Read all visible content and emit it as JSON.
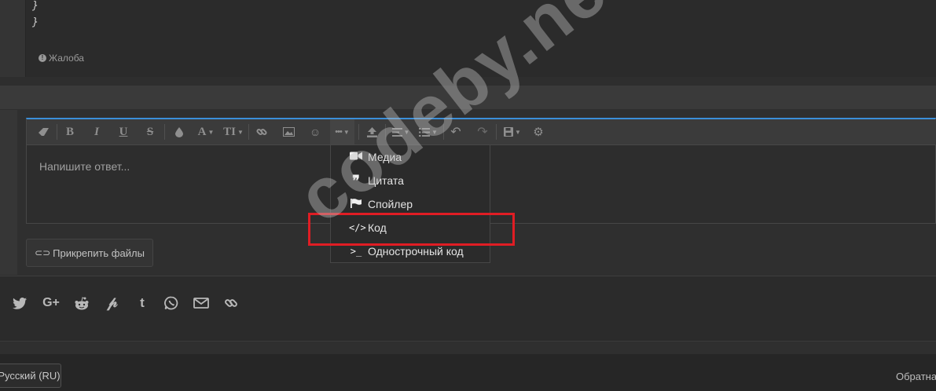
{
  "post": {
    "code_lines": [
      "}",
      "}"
    ],
    "report_label": "Жалоба"
  },
  "editor": {
    "placeholder": "Напишите ответ...",
    "toolbar_icons": [
      "eraser-icon",
      "bold-icon",
      "italic-icon",
      "underline-icon",
      "strikethrough-icon",
      "color-icon",
      "font-family-icon",
      "font-size-icon",
      "link-icon",
      "image-icon",
      "smilie-icon",
      "insert-more-icon",
      "upload-icon",
      "align-icon",
      "list-icon",
      "undo-icon",
      "redo-icon",
      "drafts-icon",
      "settings-icon"
    ],
    "toolbar_glyphs": {
      "bold": "B",
      "italic": "I",
      "underline": "U",
      "strike": "S",
      "font_family": "A",
      "font_size": "TI"
    }
  },
  "insert_menu": {
    "items": [
      {
        "label": "Медиа",
        "icon": "video-icon"
      },
      {
        "label": "Цитата",
        "icon": "quote-icon"
      },
      {
        "label": "Спойлер",
        "icon": "flag-icon"
      },
      {
        "label": "Код",
        "icon": "code-icon"
      },
      {
        "label": "Однострочный код",
        "icon": "terminal-icon"
      }
    ],
    "highlighted": "Код",
    "highlight_color": "#e01d24"
  },
  "attach": {
    "label": "Прикрепить файлы"
  },
  "share_icons": [
    "twitter-icon",
    "google-plus-icon",
    "reddit-icon",
    "pinterest-icon",
    "tumblr-icon",
    "whatsapp-icon",
    "email-icon",
    "link-icon"
  ],
  "footer": {
    "language": "Русский (RU)",
    "feedback": "Обратна"
  },
  "watermark": "codeby.net",
  "colors": {
    "accent": "#3b8fd9",
    "background": "#2e2e2e"
  }
}
